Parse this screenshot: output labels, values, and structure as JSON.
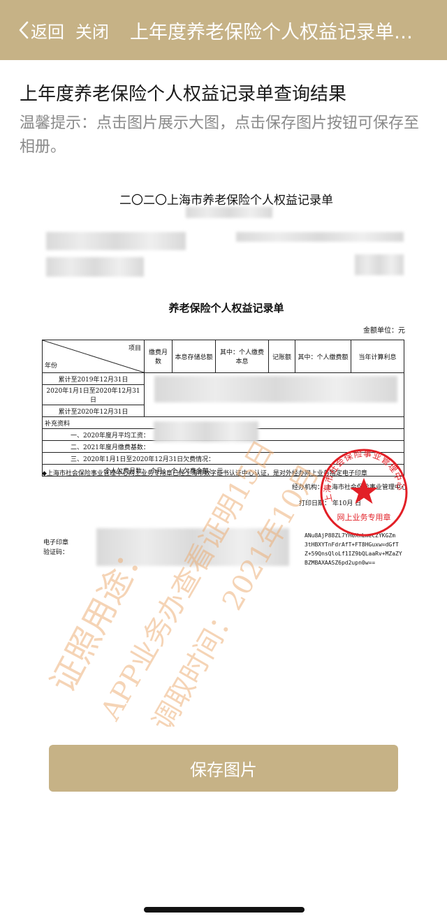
{
  "navbar": {
    "back_label": "返回",
    "close_label": "关闭",
    "title": "上年度养老保险个人权益记录单查询结果"
  },
  "page": {
    "heading": "上年度养老保险个人权益记录单查询结果",
    "tip": "温馨提示：点击图片展示大图，点击保存图片按钮可保存至相册。"
  },
  "document": {
    "main_title": "二〇二〇上海市养老保险个人权益记录单",
    "sub_title": "养老保险个人权益记录单",
    "unit": "金额单位：元",
    "table": {
      "corner_top": "项目",
      "corner_bottom": "年份",
      "columns": [
        "缴费月数",
        "本息存储总额",
        "其中：个人缴费本息",
        "记账额",
        "其中：个人缴费额",
        "当年计算利息"
      ],
      "rows": [
        "累计至2019年12月31日",
        "2020年1月1日至2020年12月31日",
        "累计至2020年12月31日"
      ],
      "supplement_title": "补充资料",
      "supplement": [
        "一、2020年度月平均工资：",
        "二、2021年度月缴费基数：",
        "三、2020年1月1日至2020年12月31日欠费情况：",
        "个人欠费月数：  个月；  个人欠费金额：  元"
      ]
    },
    "note": "◆上海市社会保险事业管理中心网上业务专用章已经上海市数字证书认证中心认证，是对外经办网上业务指定电子印章",
    "org": "经办机构：  上海市社会保险事业管理中心",
    "date": "打印日期：     年10月   日",
    "eseal_label_1": "电子印章",
    "eseal_label_2": "验证码：",
    "eseal_code": [
      "ANu8AjP88ZL7YH0XnLmeCZYKGZm",
      "3tHBXYTnFdrAfT+FT8HGuxw=dGfT",
      "Z+59QnsQloLf1IZ9bQLaaRv+MZaZY",
      "BZMBAXAASZ6pd2upn0w=="
    ],
    "stamp": {
      "ring_text": "上海市社会保险事业管理中心",
      "bottom_text": "网上业务专用章"
    },
    "watermarks": [
      "证照用途：",
      "APP业务办查看证明15日",
      "调取时间：2021年10月"
    ]
  },
  "save_button": {
    "label": "保存图片"
  },
  "colors": {
    "accent": "#c6b286",
    "stamp": "#e21f26",
    "watermark": "#ecaa6e"
  }
}
